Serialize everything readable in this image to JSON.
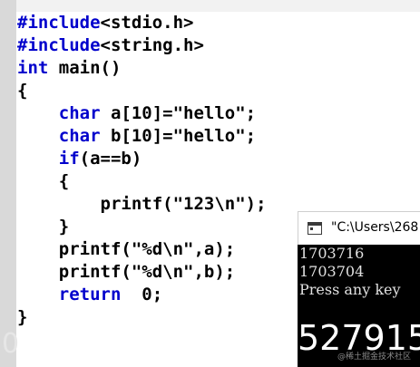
{
  "editor": {
    "lines": [
      {
        "text": "#include<stdio.h>"
      },
      {
        "text": "#include<string.h>"
      },
      {
        "text": "int main()"
      },
      {
        "text": "{"
      },
      {
        "text": "    char a[10]=\"hello\";"
      },
      {
        "text": "    char b[10]=\"hello\";"
      },
      {
        "text": "    if(a==b)"
      },
      {
        "text": "    {"
      },
      {
        "text": "        printf(\"123\\n\");"
      },
      {
        "text": "    }"
      },
      {
        "text": "    printf(\"%d\\n\",a);"
      },
      {
        "text": "    printf(\"%d\\n\",b);"
      },
      {
        "text": "    return  0;"
      },
      {
        "text": "}"
      }
    ],
    "background_fragment": "0"
  },
  "console": {
    "title": "\"C:\\Users\\268",
    "output_lines": [
      "1703716",
      "1703704",
      "Press any key"
    ],
    "large_text": "527915"
  },
  "watermark": "@稀土掘金技术社区",
  "colors": {
    "keyword": "#0000cc",
    "text": "#000000",
    "console_bg": "#000000",
    "console_text": "#e0e0e0"
  }
}
